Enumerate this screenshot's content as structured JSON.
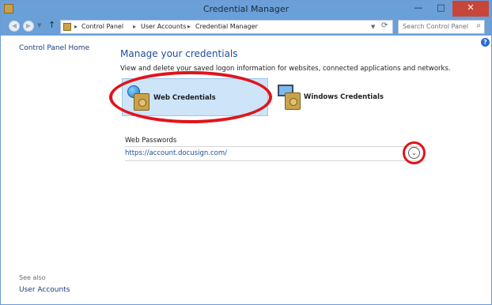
{
  "window": {
    "title": "Credential Manager",
    "buttons": {
      "minimize": "—",
      "maximize": "□",
      "close": "✕"
    }
  },
  "address": {
    "back_icon": "back-arrow-icon",
    "forward_icon": "forward-arrow-icon",
    "up_glyph": "↑",
    "breadcrumb": [
      "Control Panel",
      "User Accounts",
      "Credential Manager"
    ],
    "separator": "▸",
    "refresh_glyph": "⟳",
    "search_placeholder": "Search Control Panel",
    "search_glyph": "⌕"
  },
  "left_pane": {
    "home_link": "Control Panel Home",
    "see_also": "See also",
    "user_accounts_link": "User Accounts"
  },
  "help_glyph": "?",
  "main": {
    "heading": "Manage your credentials",
    "description": "View and delete your saved logon information for websites, connected applications and networks.",
    "tabs": [
      {
        "label": "Web Credentials",
        "selected": true
      },
      {
        "label": "Windows Credentials",
        "selected": false
      }
    ],
    "web_passwords": {
      "label": "Web Passwords",
      "entries": [
        "https://account.docusign.com/"
      ],
      "expand_glyph": "⌄"
    }
  },
  "colors": {
    "titlebar": "#6a9fd8",
    "selected_tile": "#cde4f9",
    "link": "#1f4e99",
    "annotation": "#e1141c"
  }
}
